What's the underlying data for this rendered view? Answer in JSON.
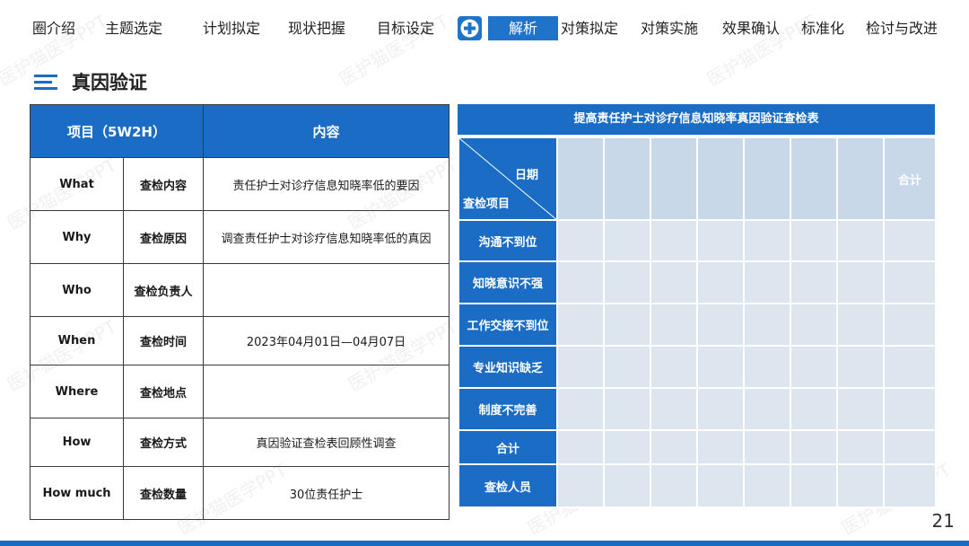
{
  "nav": {
    "items": [
      "圈介绍",
      "主题选定",
      "计划拟定",
      "现状把握",
      "目标设定"
    ],
    "active": "解析",
    "items_after": [
      "对策拟定",
      "对策实施",
      "效果确认",
      "标准化",
      "检讨与改进"
    ]
  },
  "section": {
    "title": "真因验证"
  },
  "left_table": {
    "headers": [
      "项目（5W2H）",
      "内容"
    ],
    "rows": [
      {
        "en": "What",
        "cn": "查检内容",
        "content": "责任护士对诊疗信息知晓率低的要因"
      },
      {
        "en": "Why",
        "cn": "查检原因",
        "content": "调查责任护士对诊疗信息知晓率低的真因"
      },
      {
        "en": "Who",
        "cn": "查检负责人",
        "content": ""
      },
      {
        "en": "When",
        "cn": "查检时间",
        "content": "2023年04月01日—04月07日"
      },
      {
        "en": "Where",
        "cn": "查检地点",
        "content": ""
      },
      {
        "en": "How",
        "cn": "查检方式",
        "content": "真因验证查检表回顾性调查"
      },
      {
        "en": "How much",
        "cn": "查检数量",
        "content": "30位责任护士"
      }
    ]
  },
  "right_table": {
    "title": "提高责任护士对诊疗信息知晓率真因验证查检表",
    "corner_top": "日期",
    "corner_bottom": "查检项目",
    "total_col": "合计",
    "rows": [
      "沟通不到位",
      "知晓意识不强",
      "工作交接不到位",
      "专业知识缺乏",
      "制度不完善",
      "合计",
      "查检人员"
    ]
  },
  "watermark": "医护猫医学PPT",
  "page_number": "21"
}
